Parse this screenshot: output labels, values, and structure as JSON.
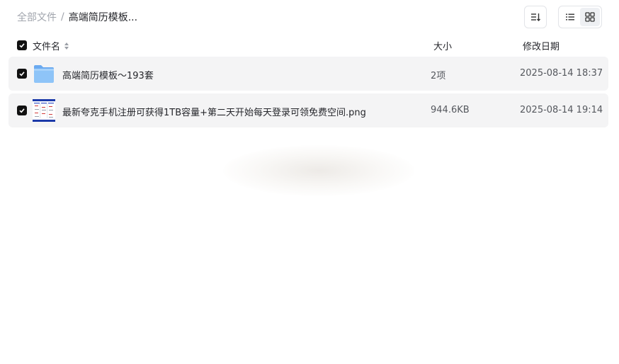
{
  "breadcrumb": {
    "root": "全部文件",
    "separator": "/",
    "current": "高端简历模板..."
  },
  "toolbar": {
    "sort_icon": "sort-icon",
    "list_view_icon": "list-view-icon",
    "grid_view_icon": "grid-view-icon"
  },
  "table": {
    "headers": {
      "name": "文件名",
      "size": "大小",
      "date": "修改日期"
    },
    "rows": [
      {
        "type": "folder",
        "icon": "folder-icon",
        "name": "高端简历模板～193套",
        "size": "2项",
        "date": "2025-08-14 18:37"
      },
      {
        "type": "image",
        "icon": "image-thumbnail",
        "name": "最新夸克手机注册可获得1TB容量+第二天开始每天登录可领免费空间.png",
        "size": "944.6KB",
        "date": "2025-08-14 19:14"
      }
    ]
  },
  "colors": {
    "row_bg": "#f4f4f5",
    "checkbox": "#111111",
    "folder": "#7fb8f5",
    "muted_text": "#a1a5ad"
  }
}
